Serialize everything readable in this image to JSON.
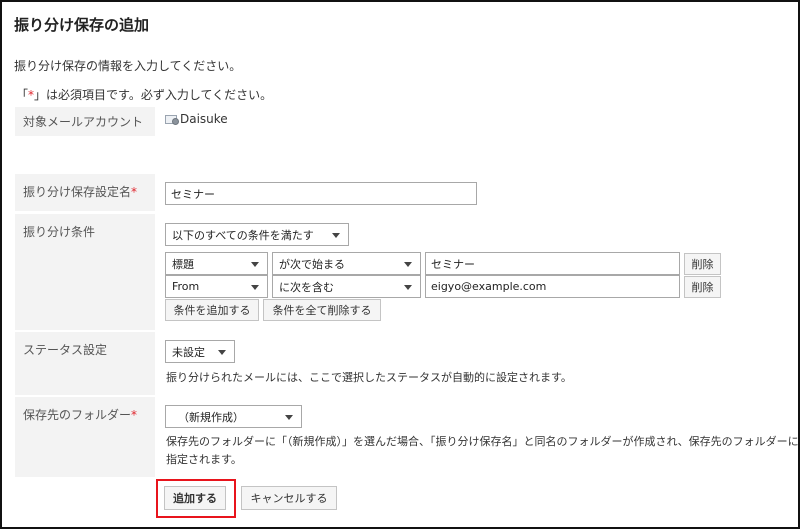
{
  "page": {
    "title": "振り分け保存の追加",
    "intro": "振り分け保存の情報を入力してください。",
    "required_note_prefix": "「",
    "required_star": "*",
    "required_note_suffix": "」は必須項目です。必ず入力してください。"
  },
  "account": {
    "label": "対象メールアカウント",
    "icon": "mail-account-icon",
    "value": "Daisuke"
  },
  "rule_name": {
    "label": "振り分け保存設定名",
    "required_star": "*",
    "value": "セミナー"
  },
  "conditions": {
    "label": "振り分け条件",
    "match_mode": "以下のすべての条件を満たす",
    "rows": [
      {
        "field": "標題",
        "operator": "が次で始まる",
        "value": "セミナー",
        "delete_label": "削除"
      },
      {
        "field": "From",
        "operator": "に次を含む",
        "value": "eigyo@example.com",
        "delete_label": "削除"
      }
    ],
    "add_label": "条件を追加する",
    "clear_label": "条件を全て削除する"
  },
  "status": {
    "label": "ステータス設定",
    "value": "未設定",
    "help": "振り分けられたメールには、ここで選択したステータスが自動的に設定されます。"
  },
  "folder": {
    "label": "保存先のフォルダー",
    "required_star": "*",
    "value": "（新規作成）",
    "help_line1": "保存先のフォルダーに「（新規作成）」を選んだ場合、「振り分け保存名」と同名のフォルダーが作成され、保存先のフォルダーに",
    "help_line2": "指定されます。"
  },
  "actions": {
    "submit_label": "追加する",
    "cancel_label": "キャンセルする"
  },
  "colors": {
    "required": "#e0262e",
    "highlight": "#e8141c",
    "label_bg": "#f3f3f3"
  }
}
